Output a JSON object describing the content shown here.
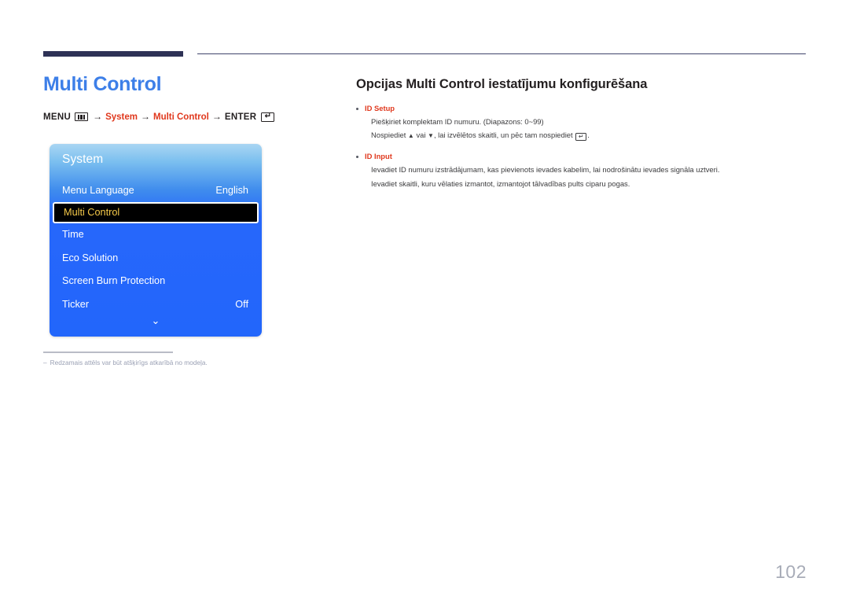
{
  "document": {
    "page_number": "102"
  },
  "left": {
    "title": "Multi Control",
    "breadcrumb": {
      "menu_label": "MENU",
      "menu_icon": "menu-grid-icon",
      "arrow": "→",
      "item1": "System",
      "item2": "Multi Control",
      "enter_label": "ENTER",
      "enter_icon": "enter-key-icon",
      "enter_glyph": "↵"
    },
    "osd": {
      "title": "System",
      "rows": [
        {
          "label": "Menu Language",
          "value": "English",
          "selected": false
        },
        {
          "label": "Multi Control",
          "value": "",
          "selected": true
        },
        {
          "label": "Time",
          "value": "",
          "selected": false
        },
        {
          "label": "Eco Solution",
          "value": "",
          "selected": false
        },
        {
          "label": "Screen Burn Protection",
          "value": "",
          "selected": false
        },
        {
          "label": "Ticker",
          "value": "Off",
          "selected": false
        }
      ],
      "scroll_icon": "chevron-down-icon",
      "scroll_glyph": "⌄"
    },
    "footnote": {
      "dash": "–",
      "text": "Redzamais attēls var būt atšķirīgs atkarībā no modeļa."
    }
  },
  "right": {
    "section_title": "Opcijas Multi Control iestatījumu konfigurēšana",
    "bullets": [
      {
        "heading": "ID Setup",
        "lines": [
          "Piešķiriet komplektam ID numuru. (Diapazons: 0~99)"
        ],
        "line_with_keys": {
          "before": "Nospiediet",
          "up_glyph": "▲",
          "middle": "vai",
          "down_glyph": "▼",
          "after": ", lai izvēlētos skaitli, un pēc tam nospiediet",
          "enter_glyph": "↵",
          "end": "."
        }
      },
      {
        "heading": "ID Input",
        "lines": [
          "Ievadiet ID numuru izstrādājumam, kas pievienots ievades kabelim, lai nodrošinātu ievades signāla uztveri.",
          "Ievadiet skaitli, kuru vēlaties izmantot, izmantojot tālvadības pults ciparu pogas."
        ]
      }
    ]
  },
  "colors": {
    "title_blue": "#3d7fe8",
    "accent_red": "#e0381d",
    "rule_navy": "#2e3256",
    "osd_blue": "#2266fb",
    "osd_selected_text": "#f5c949",
    "page_number_gray": "#a8acb8"
  }
}
